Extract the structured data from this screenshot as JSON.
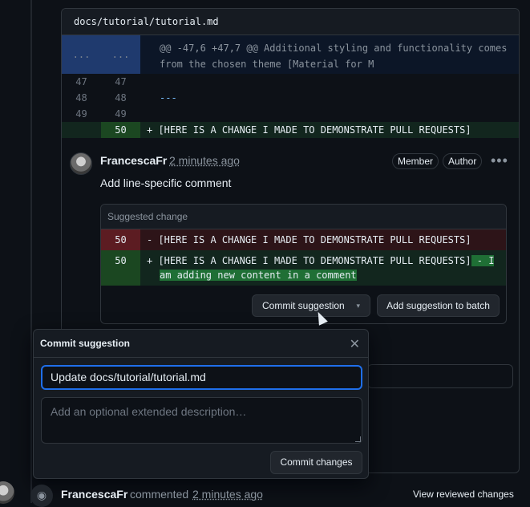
{
  "file": {
    "path": "docs/tutorial/tutorial.md"
  },
  "hunk": {
    "left": "...",
    "right": "...",
    "text": "@@ -47,6 +47,7 @@ Additional styling and functionality comes from the chosen theme [Material for M"
  },
  "diff_rows": [
    {
      "old": "47",
      "new": "47",
      "code": ""
    },
    {
      "old": "48",
      "new": "48",
      "code": "---"
    },
    {
      "old": "49",
      "new": "49",
      "code": ""
    },
    {
      "old": "",
      "new": "50",
      "code": "+ [HERE IS A CHANGE I MADE TO DEMONSTRATE PULL REQUESTS]"
    }
  ],
  "comment": {
    "author": "FrancescaFr",
    "time": "2 minutes ago",
    "badges": [
      "Member",
      "Author"
    ],
    "more_icon": "kebab-horizontal-icon",
    "body": "Add line-specific comment",
    "suggestion": {
      "header": "Suggested change",
      "deleted": {
        "line": "50",
        "code": "- [HERE IS A CHANGE I MADE TO DEMONSTRATE PULL REQUESTS]"
      },
      "added": {
        "line": "50",
        "code_prefix": "+ [HERE IS A CHANGE I MADE TO DEMONSTRATE PULL REQUESTS]",
        "code_highlight_1": " - I",
        "code_highlight_2": "am adding new content in a comment"
      },
      "commit_button": "Commit suggestion",
      "batch_button": "Add suggestion to batch"
    }
  },
  "popover": {
    "title": "Commit suggestion",
    "close_icon": "x-icon",
    "title_value": "Update docs/tutorial/tutorial.md",
    "description_placeholder": "Add an optional extended description…",
    "submit": "Commit changes"
  },
  "timeline": {
    "author": "FrancescaFr",
    "action": "commented",
    "time": "2 minutes ago",
    "icon": "eye-icon",
    "view_link": "View reviewed changes"
  },
  "colors": {
    "background": "#0d1117",
    "accent": "#1f6feb",
    "addition": "#12261e",
    "deletion": "#2d1418"
  }
}
